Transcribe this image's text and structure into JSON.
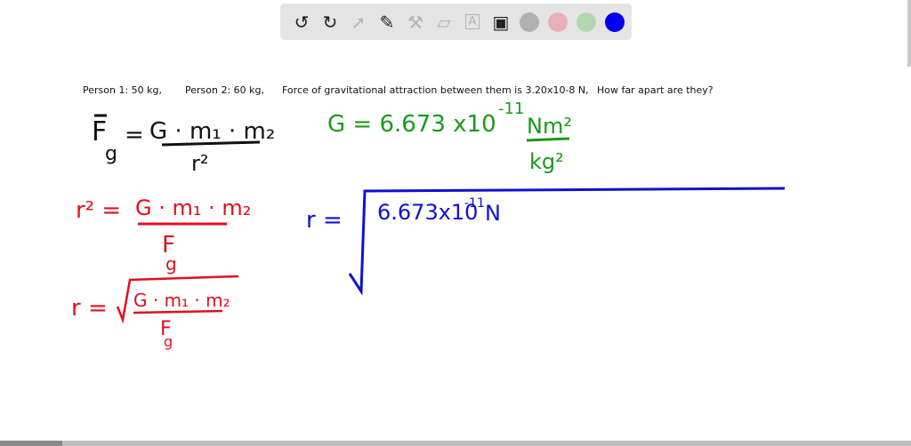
{
  "toolbar": {
    "tools": [
      {
        "name": "undo-icon",
        "glyph": "↺",
        "enabled": true
      },
      {
        "name": "redo-icon",
        "glyph": "↻",
        "enabled": true
      },
      {
        "name": "select-pointer-icon",
        "glyph": "➚",
        "enabled": false
      },
      {
        "name": "pen-icon",
        "glyph": "✎",
        "enabled": true
      },
      {
        "name": "tools-icon",
        "glyph": "⚒",
        "enabled": false
      },
      {
        "name": "eraser-icon",
        "glyph": "▱",
        "enabled": false
      },
      {
        "name": "text-box-icon",
        "glyph": "A",
        "enabled": false
      },
      {
        "name": "image-icon",
        "glyph": "▣",
        "enabled": true
      }
    ],
    "colors": [
      "#b0b0b0",
      "#eab0b8",
      "#b2d8b2",
      "#0000ee"
    ]
  },
  "prompt": {
    "p1": "Person 1:   50 kg,",
    "p2": "Person 2:  60 kg,",
    "force": "Force of gravitational attraction between them is 3.20x10-8 N,",
    "question": "How far apart are they?"
  },
  "handwriting": {
    "black_formula": {
      "lhs": "F",
      "lhs_sub": "g",
      "num": "G · m₁ · m₂",
      "den": "r²"
    },
    "green_constant": {
      "lhs": "G = 6.673 x10",
      "exp": "-11",
      "unit_num": "Nm²",
      "unit_den": "kg²"
    },
    "red_r2": {
      "lhs": "r² =",
      "num": "G · m₁ · m₂",
      "den": "F",
      "den_sub": "g"
    },
    "red_r": {
      "lhs": "r =",
      "num": "G · m₁ · m₂",
      "den": "F",
      "den_sub": "g"
    },
    "blue_r": {
      "lhs": "r =",
      "content": "6.673x10",
      "exp": "-11",
      "unit": "N"
    }
  },
  "colors": {
    "black": "#111111",
    "green": "#1a9a1a",
    "red": "#e01020",
    "blue": "#1010d0"
  }
}
